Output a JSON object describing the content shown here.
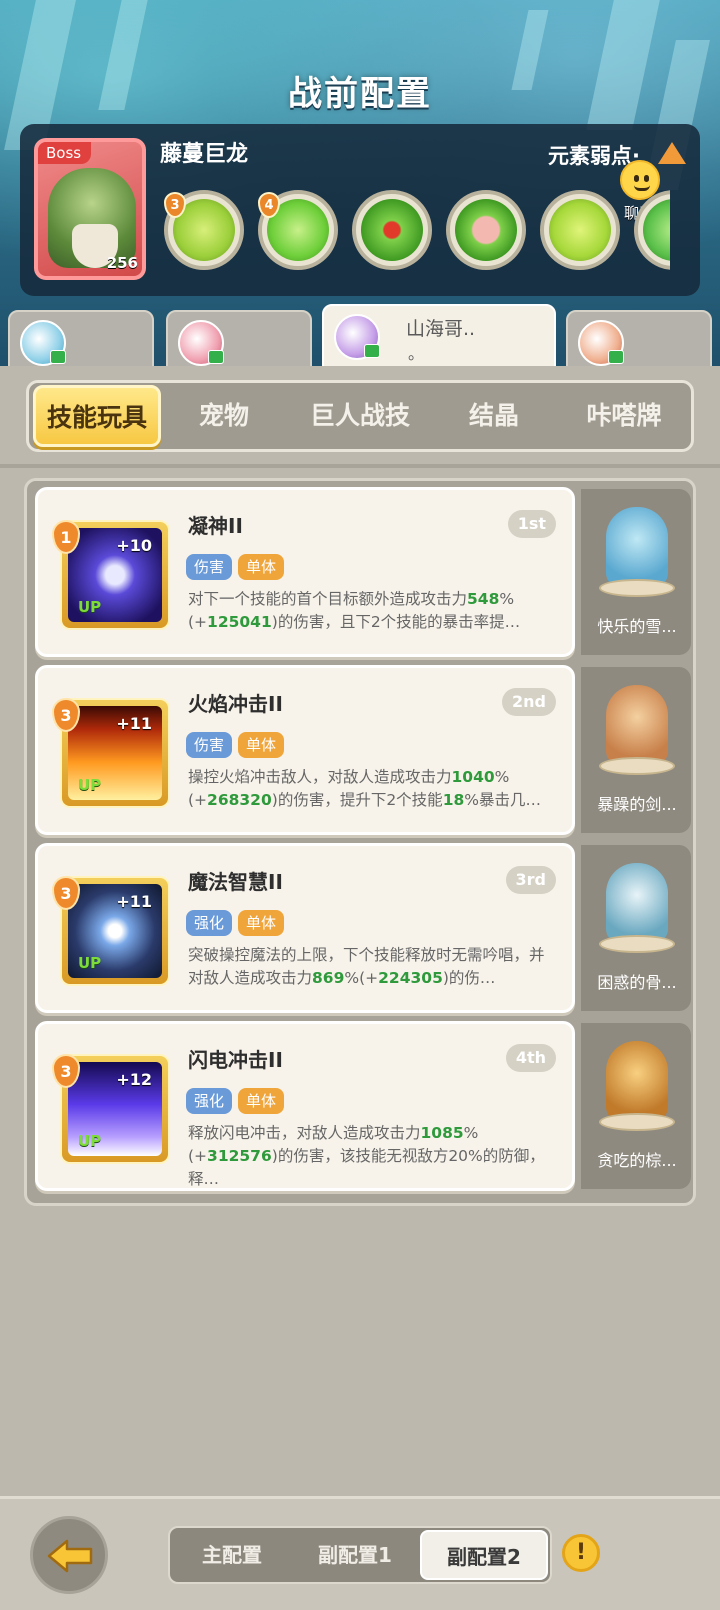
{
  "header": {
    "title": "战前配置"
  },
  "boss": {
    "tag": "Boss",
    "name": "藤蔓巨龙",
    "level": "256",
    "weakness_label": "元素弱点·",
    "chat_label": "聊天",
    "skills": [
      {
        "icon": "green-beast-mask-icon",
        "badge": "3",
        "color": "#9bcf3a"
      },
      {
        "icon": "green-flame-icon",
        "badge": "4",
        "color": "#6ecf3a"
      },
      {
        "icon": "red-drop-icon",
        "badge": "",
        "color": "#4fae2e"
      },
      {
        "icon": "pig-face-icon",
        "badge": "",
        "color": "#7fd04a"
      },
      {
        "icon": "green-slime-icon",
        "badge": "",
        "color": "#a6d83a"
      },
      {
        "icon": "partial-skill-icon",
        "badge": "",
        "color": "#5ac04a"
      }
    ]
  },
  "teammates": [
    {
      "name": "",
      "active": false
    },
    {
      "name": "",
      "active": false
    },
    {
      "name": "山海哥..",
      "sub": "。",
      "active": true
    },
    {
      "name": "",
      "active": false
    }
  ],
  "tabs": [
    "技能玩具",
    "宠物",
    "巨人战技",
    "结晶",
    "咔嗒牌"
  ],
  "skills": [
    {
      "name": "凝神II",
      "rank": "1st",
      "level": "1",
      "plus": "+10",
      "up": "UP",
      "tags": [
        "伤害",
        "单体"
      ],
      "desc_parts": [
        {
          "t": "对下一个技能的首个目标额外造成攻击力",
          "g": false
        },
        {
          "t": "548",
          "g": true
        },
        {
          "t": "%(+",
          "g": false
        },
        {
          "t": "125041",
          "g": true
        },
        {
          "t": ")的伤害，且下2个技能的暴击率提…",
          "g": false
        }
      ],
      "pet": "快乐的雪..."
    },
    {
      "name": "火焰冲击II",
      "rank": "2nd",
      "level": "3",
      "plus": "+11",
      "up": "UP",
      "tags": [
        "伤害",
        "单体"
      ],
      "desc_parts": [
        {
          "t": "操控火焰冲击敌人，对敌人造成攻击力",
          "g": false
        },
        {
          "t": "1040",
          "g": true
        },
        {
          "t": "%(+",
          "g": false
        },
        {
          "t": "268320",
          "g": true
        },
        {
          "t": ")的伤害，提升下2个技能",
          "g": false
        },
        {
          "t": "18",
          "g": true
        },
        {
          "t": "%暴击几…",
          "g": false
        }
      ],
      "pet": "暴躁的剑..."
    },
    {
      "name": "魔法智慧II",
      "rank": "3rd",
      "level": "3",
      "plus": "+11",
      "up": "UP",
      "tags": [
        "强化",
        "单体"
      ],
      "desc_parts": [
        {
          "t": "突破操控魔法的上限，下个技能释放时无需吟唱，并对敌人造成攻击力",
          "g": false
        },
        {
          "t": "869",
          "g": true
        },
        {
          "t": "%(+",
          "g": false
        },
        {
          "t": "224305",
          "g": true
        },
        {
          "t": ")的伤…",
          "g": false
        }
      ],
      "pet": "困惑的骨..."
    },
    {
      "name": "闪电冲击II",
      "rank": "4th",
      "level": "3",
      "plus": "+12",
      "up": "UP",
      "tags": [
        "强化",
        "单体"
      ],
      "desc_parts": [
        {
          "t": "释放闪电冲击，对敌人造成攻击力",
          "g": false
        },
        {
          "t": "1085",
          "g": true
        },
        {
          "t": "%(+",
          "g": false
        },
        {
          "t": "312576",
          "g": true
        },
        {
          "t": ")的伤害，该技能无视敌方20%的防御，释…",
          "g": false
        }
      ],
      "pet": "贪吃的棕..."
    }
  ],
  "config_tabs": [
    "主配置",
    "副配置1",
    "副配置2"
  ],
  "active_config": 2,
  "hint_icon": "!",
  "colors": {
    "accent": "#f7c843",
    "highlight": "#2f9a3c",
    "boss_red": "#e0413e"
  }
}
